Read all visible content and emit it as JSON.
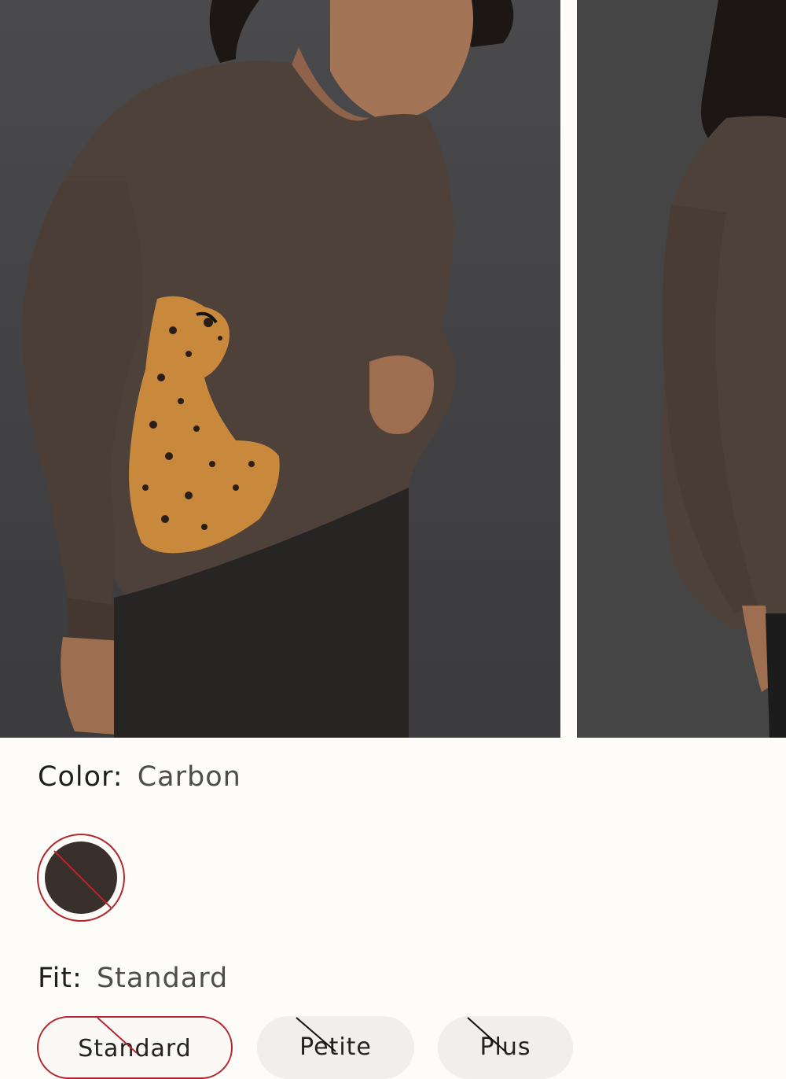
{
  "product": {
    "gallery": {
      "images": [
        {
          "name": "front-view"
        },
        {
          "name": "back-view"
        }
      ]
    },
    "color": {
      "label": "Color:",
      "value": "Carbon",
      "swatches": [
        {
          "name": "Carbon",
          "hex": "#3a302b",
          "selected": true,
          "unavailable": true
        }
      ]
    },
    "fit": {
      "label": "Fit:",
      "value": "Standard",
      "options": [
        {
          "label": "Standard",
          "selected": true,
          "unavailable": true
        },
        {
          "label": "Petite",
          "selected": false,
          "unavailable": true
        },
        {
          "label": "Plus",
          "selected": false,
          "unavailable": true
        }
      ]
    }
  },
  "colors": {
    "accent": "#b3262d",
    "background": "#fdfcf8",
    "pill": "#f0efeb"
  }
}
